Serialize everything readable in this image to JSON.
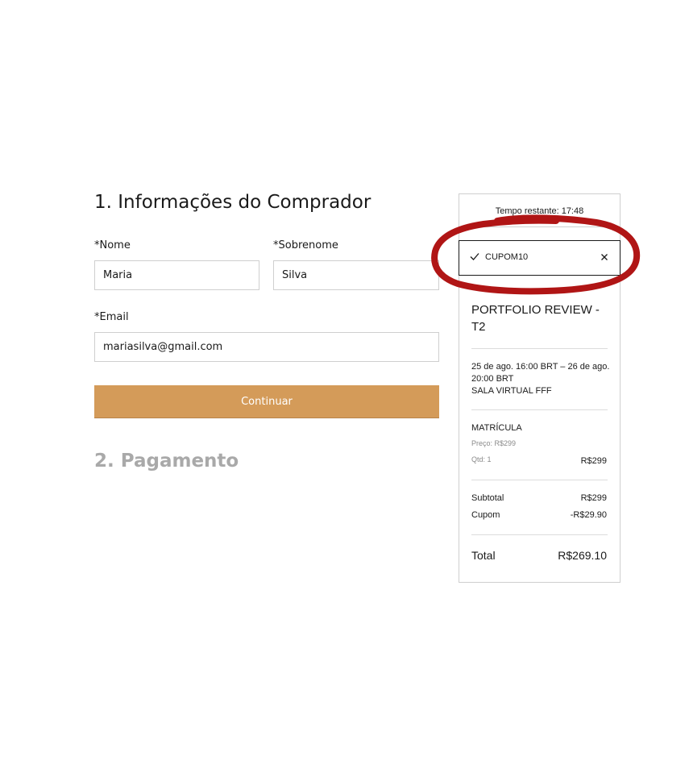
{
  "form": {
    "step1_title": "1.  Informações do Comprador",
    "first_name_label": "*Nome",
    "first_name_value": "Maria",
    "last_name_label": "*Sobrenome",
    "last_name_value": "Silva",
    "email_label": "*Email",
    "email_value": "mariasilva@gmail.com",
    "continue_label": "Continuar",
    "step2_title": "2.  Pagamento"
  },
  "summary": {
    "timer": "Tempo restante: 17:48",
    "coupon_code": "CUPOM10",
    "event_title": "PORTFOLIO REVIEW - T2",
    "event_date": "25 de ago. 16:00 BRT – 26 de ago. 20:00 BRT",
    "event_location": "SALA VIRTUAL FFF",
    "ticket_name": "MATRÍCULA",
    "ticket_price": "Preço: R$299",
    "ticket_qty": "Qtd: 1",
    "ticket_amount": "R$299",
    "subtotal_label": "Subtotal",
    "subtotal_value": "R$299",
    "coupon_label": "Cupom",
    "coupon_value": "-R$29.90",
    "total_label": "Total",
    "total_value": "R$269.10"
  },
  "colors": {
    "continue_button": "#d49b59",
    "annotation_red": "#b01515",
    "step2_inactive": "#a9a9a9"
  },
  "icons": {
    "coupon_applied": "check-icon",
    "coupon_remove": "close-icon"
  }
}
